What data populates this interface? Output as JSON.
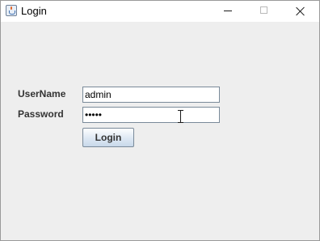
{
  "window": {
    "title": "Login",
    "icon": "java-cup-icon",
    "controls": {
      "minimize_icon": "minimize-icon",
      "maximize_icon": "maximize-icon",
      "close_icon": "close-icon"
    }
  },
  "form": {
    "username_label": "UserName",
    "username_value": "admin",
    "password_label": "Password",
    "password_value": "•••••",
    "login_label": "Login"
  },
  "colors": {
    "background": "#eeeeee",
    "titlebar": "#ffffff",
    "field_border": "#7a8a99"
  }
}
